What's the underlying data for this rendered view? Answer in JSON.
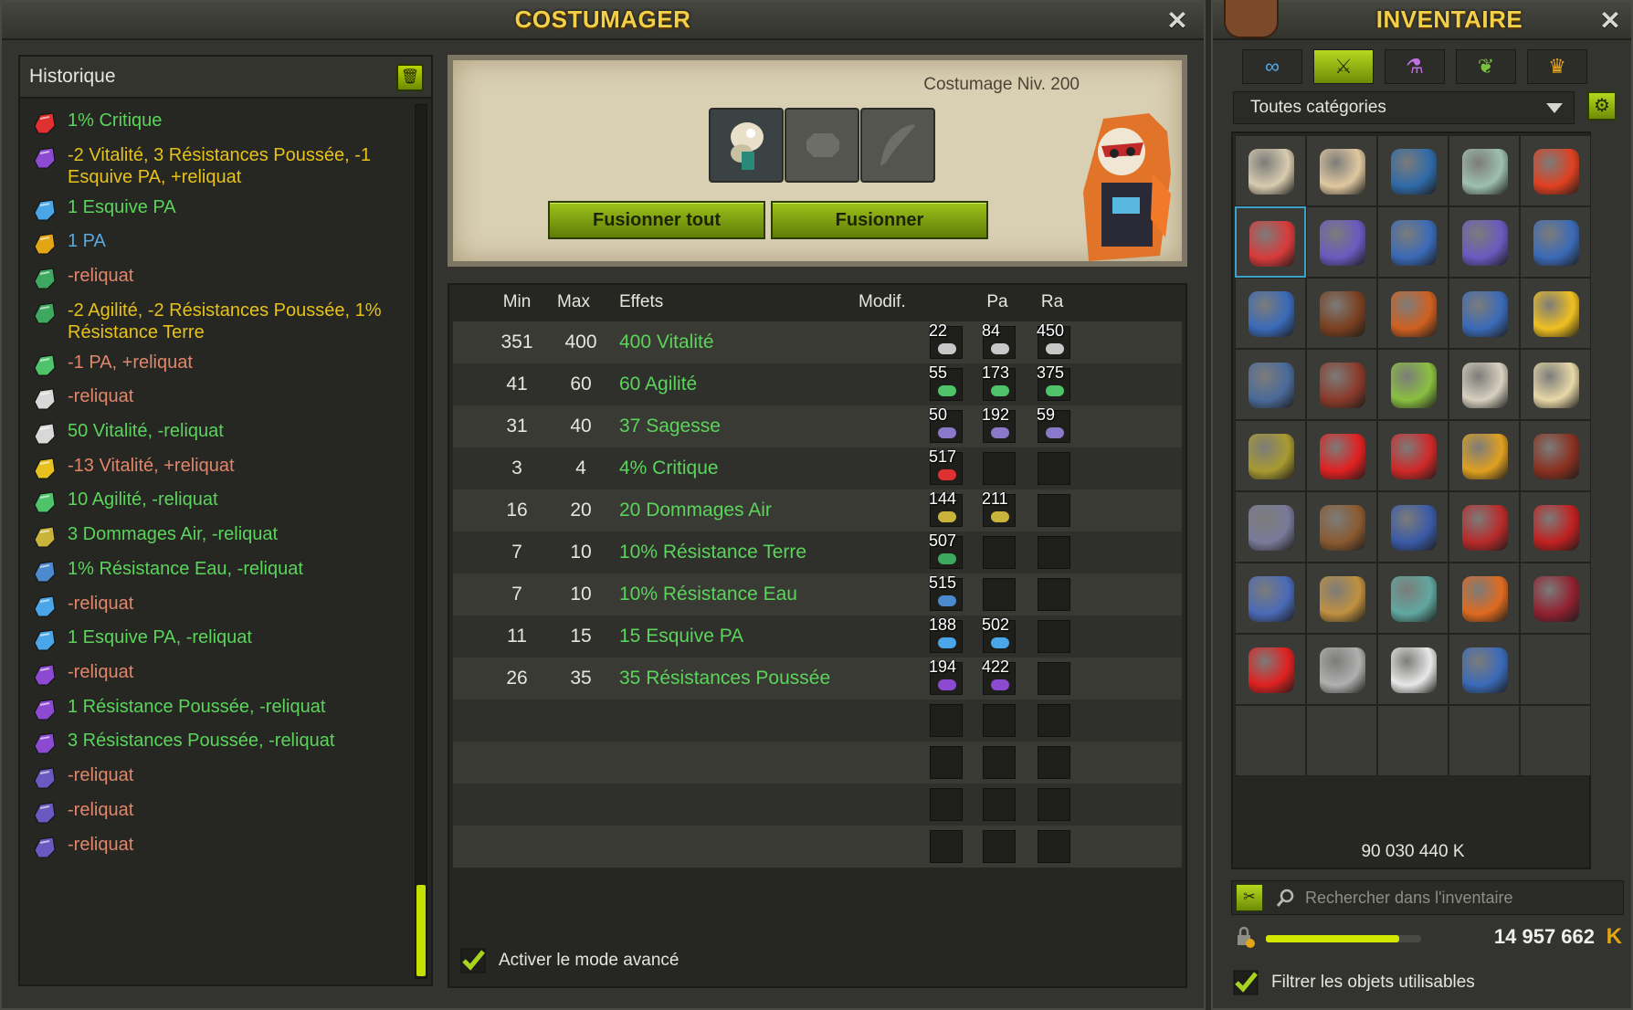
{
  "costumager": {
    "title": "COSTUMAGER",
    "close": "✕",
    "history": {
      "title": "Historique",
      "items": [
        {
          "text": "1% Critique",
          "color": "#5bd45b",
          "icon": "red-rune-icon"
        },
        {
          "text": "-2 Vitalité, 3 Résistances Poussée, -1 Esquive PA, +reliquat",
          "color": "#e6c21a",
          "icon": "purple-potion-icon"
        },
        {
          "text": "1 Esquive PA",
          "color": "#5bd45b",
          "icon": "blue-potion-icon"
        },
        {
          "text": "1 PA",
          "color": "#5aa8e0",
          "icon": "gold-pa-rune-icon"
        },
        {
          "text": "-reliquat",
          "color": "#e0866a",
          "icon": "green-potion-icon"
        },
        {
          "text": "-2 Agilité, -2 Résistances Poussée, 1% Résistance Terre",
          "color": "#e6c21a",
          "icon": "green-potion-icon"
        },
        {
          "text": "-1 PA, +reliquat",
          "color": "#e0866a",
          "icon": "green-rune-icon"
        },
        {
          "text": "-reliquat",
          "color": "#e0866a",
          "icon": "white-rune-icon"
        },
        {
          "text": "50 Vitalité, -reliquat",
          "color": "#5bd45b",
          "icon": "white-rune-icon"
        },
        {
          "text": "-13 Vitalité, +reliquat",
          "color": "#e0866a",
          "icon": "banana-icon"
        },
        {
          "text": "10 Agilité, -reliquat",
          "color": "#5bd45b",
          "icon": "green-rune-icon"
        },
        {
          "text": "3 Dommages Air, -reliquat",
          "color": "#5bd45b",
          "icon": "air-rune-icon"
        },
        {
          "text": "1% Résistance Eau, -reliquat",
          "color": "#5bd45b",
          "icon": "water-rune-icon"
        },
        {
          "text": "-reliquat",
          "color": "#e0866a",
          "icon": "blue-potion-icon"
        },
        {
          "text": "1 Esquive PA, -reliquat",
          "color": "#5bd45b",
          "icon": "blue-potion-icon"
        },
        {
          "text": "-reliquat",
          "color": "#e0866a",
          "icon": "purple-potion-icon"
        },
        {
          "text": "1 Résistance Poussée, -reliquat",
          "color": "#5bd45b",
          "icon": "purple-potion-icon"
        },
        {
          "text": "3 Résistances Poussée, -reliquat",
          "color": "#5bd45b",
          "icon": "purple-potion-icon"
        },
        {
          "text": "-reliquat",
          "color": "#e0866a",
          "icon": "purple-rune-icon"
        },
        {
          "text": "-reliquat",
          "color": "#e0866a",
          "icon": "purple-rune-icon"
        },
        {
          "text": "-reliquat",
          "color": "#e0866a",
          "icon": "purple-rune-icon"
        }
      ]
    },
    "preview": {
      "level_label": "Costumage Niv. 200",
      "fuse_all": "Fusionner tout",
      "fuse": "Fusionner"
    },
    "effects": {
      "headers": {
        "min": "Min",
        "max": "Max",
        "effects": "Effets",
        "modif": "Modif.",
        "pa": "Pa",
        "ra": "Ra"
      },
      "rows": [
        {
          "min": "351",
          "max": "400",
          "effect": "400 Vitalité",
          "runes": [
            {
              "n": "22",
              "c": "#c8c8c8"
            },
            {
              "n": "84",
              "c": "#c8c8c8"
            },
            {
              "n": "450",
              "c": "#c8c8c8"
            }
          ]
        },
        {
          "min": "41",
          "max": "60",
          "effect": "60 Agilité",
          "runes": [
            {
              "n": "55",
              "c": "#4ec36a"
            },
            {
              "n": "173",
              "c": "#4ec36a"
            },
            {
              "n": "375",
              "c": "#4ec36a"
            }
          ]
        },
        {
          "min": "31",
          "max": "40",
          "effect": "37 Sagesse",
          "runes": [
            {
              "n": "50",
              "c": "#8a78c8"
            },
            {
              "n": "192",
              "c": "#8a78c8"
            },
            {
              "n": "59",
              "c": "#8a78c8"
            }
          ]
        },
        {
          "min": "3",
          "max": "4",
          "effect": "4% Critique",
          "runes": [
            {
              "n": "517",
              "c": "#e03030"
            },
            {
              "n": "",
              "c": ""
            },
            {
              "n": "",
              "c": ""
            }
          ]
        },
        {
          "min": "16",
          "max": "20",
          "effect": "20 Dommages Air",
          "runes": [
            {
              "n": "144",
              "c": "#c8b43a"
            },
            {
              "n": "211",
              "c": "#c8b43a"
            },
            {
              "n": "",
              "c": ""
            }
          ]
        },
        {
          "min": "7",
          "max": "10",
          "effect": "10% Résistance Terre",
          "runes": [
            {
              "n": "507",
              "c": "#3fa860"
            },
            {
              "n": "",
              "c": ""
            },
            {
              "n": "",
              "c": ""
            }
          ]
        },
        {
          "min": "7",
          "max": "10",
          "effect": "10% Résistance Eau",
          "runes": [
            {
              "n": "515",
              "c": "#4c8ad0"
            },
            {
              "n": "",
              "c": ""
            },
            {
              "n": "",
              "c": ""
            }
          ]
        },
        {
          "min": "11",
          "max": "15",
          "effect": "15 Esquive PA",
          "runes": [
            {
              "n": "188",
              "c": "#4aa6e6"
            },
            {
              "n": "502",
              "c": "#4aa6e6"
            },
            {
              "n": "",
              "c": ""
            }
          ]
        },
        {
          "min": "26",
          "max": "35",
          "effect": "35 Résistances Poussée",
          "runes": [
            {
              "n": "194",
              "c": "#8c4ad0"
            },
            {
              "n": "422",
              "c": "#8c4ad0"
            },
            {
              "n": "",
              "c": ""
            }
          ]
        },
        {
          "min": "",
          "max": "",
          "effect": "",
          "runes": [
            {
              "n": "",
              "c": ""
            },
            {
              "n": "",
              "c": ""
            },
            {
              "n": "",
              "c": ""
            }
          ]
        },
        {
          "min": "",
          "max": "",
          "effect": "",
          "runes": [
            {
              "n": "",
              "c": ""
            },
            {
              "n": "",
              "c": ""
            },
            {
              "n": "",
              "c": ""
            }
          ]
        },
        {
          "min": "",
          "max": "",
          "effect": "",
          "runes": [
            {
              "n": "",
              "c": ""
            },
            {
              "n": "",
              "c": ""
            },
            {
              "n": "",
              "c": ""
            }
          ]
        },
        {
          "min": "",
          "max": "",
          "effect": "",
          "runes": [
            {
              "n": "",
              "c": ""
            },
            {
              "n": "",
              "c": ""
            },
            {
              "n": "",
              "c": ""
            }
          ]
        }
      ],
      "advanced_mode": "Activer le mode avancé"
    }
  },
  "inventaire": {
    "title": "INVENTAIRE",
    "close": "✕",
    "tabs": [
      {
        "icon": "infinity-icon",
        "glyph": "∞",
        "color": "#5aa8f0"
      },
      {
        "icon": "sword-icon",
        "glyph": "⚔",
        "color": "#2a3a10"
      },
      {
        "icon": "potion-icon",
        "glyph": "⚗",
        "color": "#c070e0"
      },
      {
        "icon": "leaf-icon",
        "glyph": "❦",
        "color": "#7ac040"
      },
      {
        "icon": "crown-icon",
        "glyph": "♛",
        "color": "#e8a620"
      }
    ],
    "category": "Toutes catégories",
    "items": [
      "#d8ccb0",
      "#e0c8a0",
      "#2e6aa8",
      "#9ec0b0",
      "#e04020",
      "#d83a3a",
      "#6a5ac0",
      "#3a6ab8",
      "#6a5ac0",
      "#3a6ab8",
      "#3a6ab8",
      "#7a4020",
      "#d06020",
      "#3a6ab8",
      "#f0c020",
      "#4a6a9a",
      "#8a3a2a",
      "#8ac040",
      "#d8d0c0",
      "#e8d8a8",
      "#a89a30",
      "#e02020",
      "#d02828",
      "#e0a020",
      "#8a3020",
      "#7a7a9a",
      "#8a5a30",
      "#3a5aa8",
      "#b82a2a",
      "#c02020",
      "#4a6ab8",
      "#c09040",
      "#60a8a0",
      "#e06a20",
      "#902030",
      "#e02020",
      "#b0b0b0",
      "#e8e8e8",
      "#3a6ab8"
    ],
    "kamas_total": "90 030 440 K",
    "search_placeholder": "Rechercher dans l'inventaire",
    "kamas": "14 957 662",
    "kamas_icon": "K",
    "pods_fill": 0.86,
    "filter": "Filtrer les objets utilisables"
  }
}
